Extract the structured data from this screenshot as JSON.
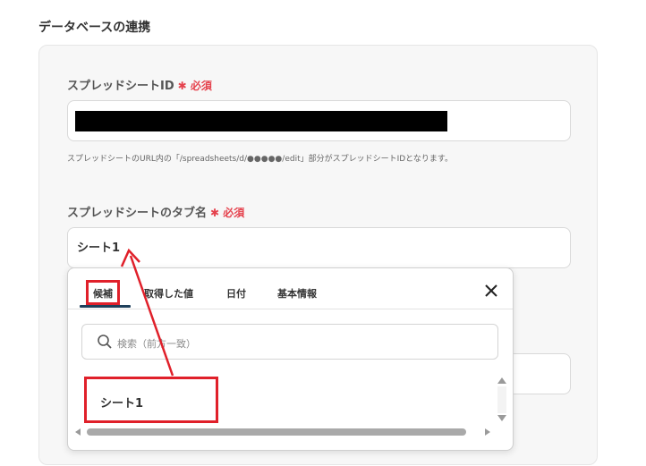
{
  "section": {
    "title": "データベースの連携"
  },
  "sheet_id_field": {
    "label": "スプレッドシートID",
    "required_mark": "✱",
    "required_text": "必須"
  },
  "help_text": "スプレッドシートのURL内の「/spreadsheets/d/●●●●●/edit」部分がスプレッドシートIDとなります。",
  "tab_name_field": {
    "label": "スプレッドシートのタブ名",
    "required_mark": "✱",
    "required_text": "必須",
    "value": "シート1"
  },
  "dropdown": {
    "tabs": [
      {
        "label": "候補"
      },
      {
        "label": "取得した値"
      },
      {
        "label": "日付"
      },
      {
        "label": "基本情報"
      }
    ],
    "search_placeholder": "検索（前方一致）",
    "options": [
      {
        "label": "シート1"
      }
    ]
  },
  "colors": {
    "accent": "#1e3f5a",
    "required": "#e5424d",
    "highlight": "#e0202a"
  }
}
